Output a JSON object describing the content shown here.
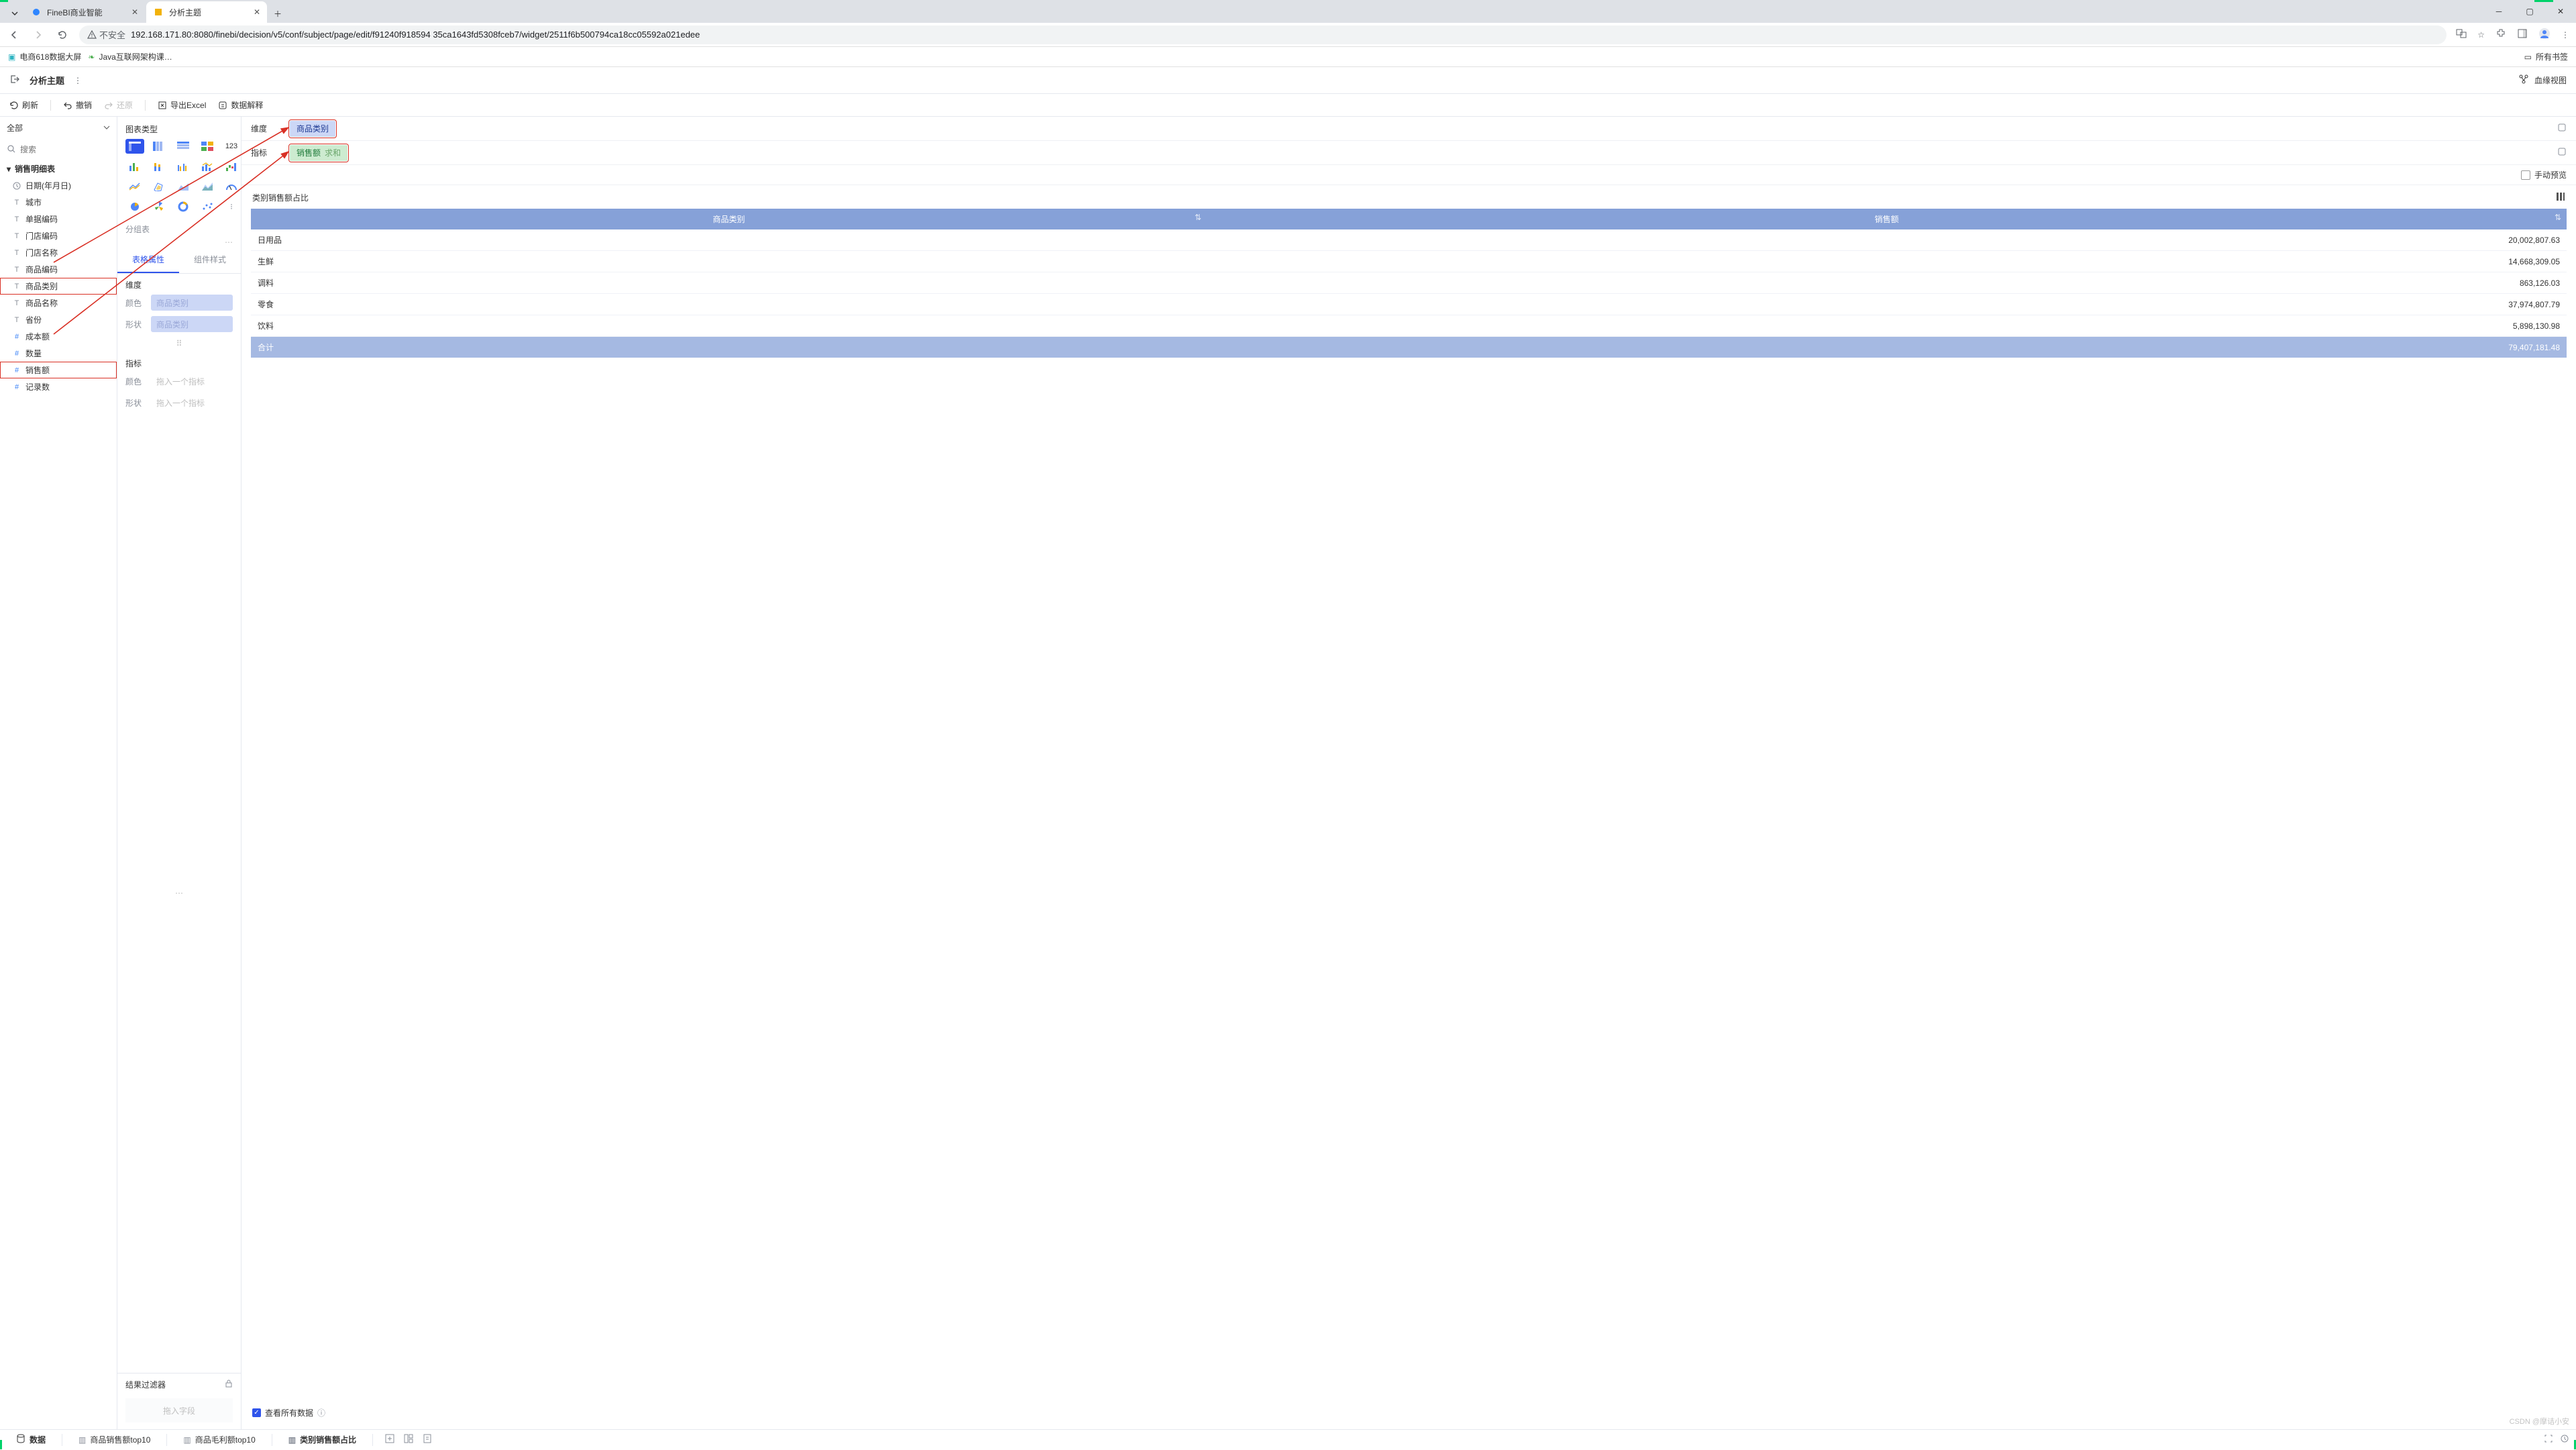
{
  "browser": {
    "tabs": [
      {
        "title": "FineBI商业智能",
        "active": false
      },
      {
        "title": "分析主题",
        "active": true
      }
    ],
    "url": "192.168.171.80:8080/finebi/decision/v5/conf/subject/page/edit/f91240f918594 35ca1643fd5308fceb7/widget/2511f6b500794ca18cc05592a021edee",
    "not_secure": "不安全",
    "bookmarks": [
      {
        "label": "电商618数据大屏"
      },
      {
        "label": "Java互联网架构课…"
      }
    ],
    "all_bookmarks": "所有书签"
  },
  "app": {
    "back_label": "",
    "title": "分析主题",
    "lineage": "血缘视图"
  },
  "toolbar": {
    "refresh": "刷新",
    "undo": "撤销",
    "redo": "还原",
    "export_excel": "导出Excel",
    "data_explain": "数据解释"
  },
  "left": {
    "selector": "全部",
    "search_placeholder": "搜索",
    "table_name": "销售明细表",
    "fields": [
      {
        "icon": "clock",
        "label": "日期(年月日)"
      },
      {
        "icon": "T",
        "label": "城市"
      },
      {
        "icon": "T",
        "label": "单据编码"
      },
      {
        "icon": "T",
        "label": "门店编码"
      },
      {
        "icon": "T",
        "label": "门店名称"
      },
      {
        "icon": "T",
        "label": "商品编码"
      },
      {
        "icon": "T",
        "label": "商品类别",
        "hl": true
      },
      {
        "icon": "T",
        "label": "商品名称"
      },
      {
        "icon": "T",
        "label": "省份"
      },
      {
        "icon": "#",
        "label": "成本额"
      },
      {
        "icon": "#",
        "label": "数量"
      },
      {
        "icon": "#",
        "label": "销售额",
        "hl": true
      },
      {
        "icon": "#",
        "label": "记录数"
      }
    ]
  },
  "mid": {
    "chart_type_title": "图表类型",
    "chart_type_number": "123",
    "pivot_title": "分组表",
    "tab_attr": "表格属性",
    "tab_style": "组件样式",
    "group_dim": "维度",
    "group_mea": "指标",
    "row_color": "颜色",
    "row_shape": "形状",
    "chip_dim": "商品类别",
    "ph_metric": "拖入一个指标",
    "result_filter": "结果过滤器",
    "drop_field": "拖入字段"
  },
  "right": {
    "shelf_dim": "维度",
    "shelf_mea": "指标",
    "pill_dim": "商品类别",
    "pill_mea": "销售额",
    "pill_agg": "求和",
    "manual_preview": "手动预览",
    "viz_title": "类别销售额占比",
    "col1": "商品类别",
    "col2": "销售额",
    "rows": [
      {
        "c": "日用品",
        "v": "20,002,807.63"
      },
      {
        "c": "生鲜",
        "v": "14,668,309.05"
      },
      {
        "c": "调料",
        "v": "863,126.03"
      },
      {
        "c": "零食",
        "v": "37,974,807.79"
      },
      {
        "c": "饮料",
        "v": "5,898,130.98"
      }
    ],
    "total_label": "合计",
    "total_value": "79,407,181.48",
    "view_all": "查看所有数据"
  },
  "bottom": {
    "data": "数据",
    "tabs": [
      "商品销售额top10",
      "商品毛利额top10",
      "类别销售额占比"
    ]
  },
  "watermark": "CSDN @摩诘小安"
}
